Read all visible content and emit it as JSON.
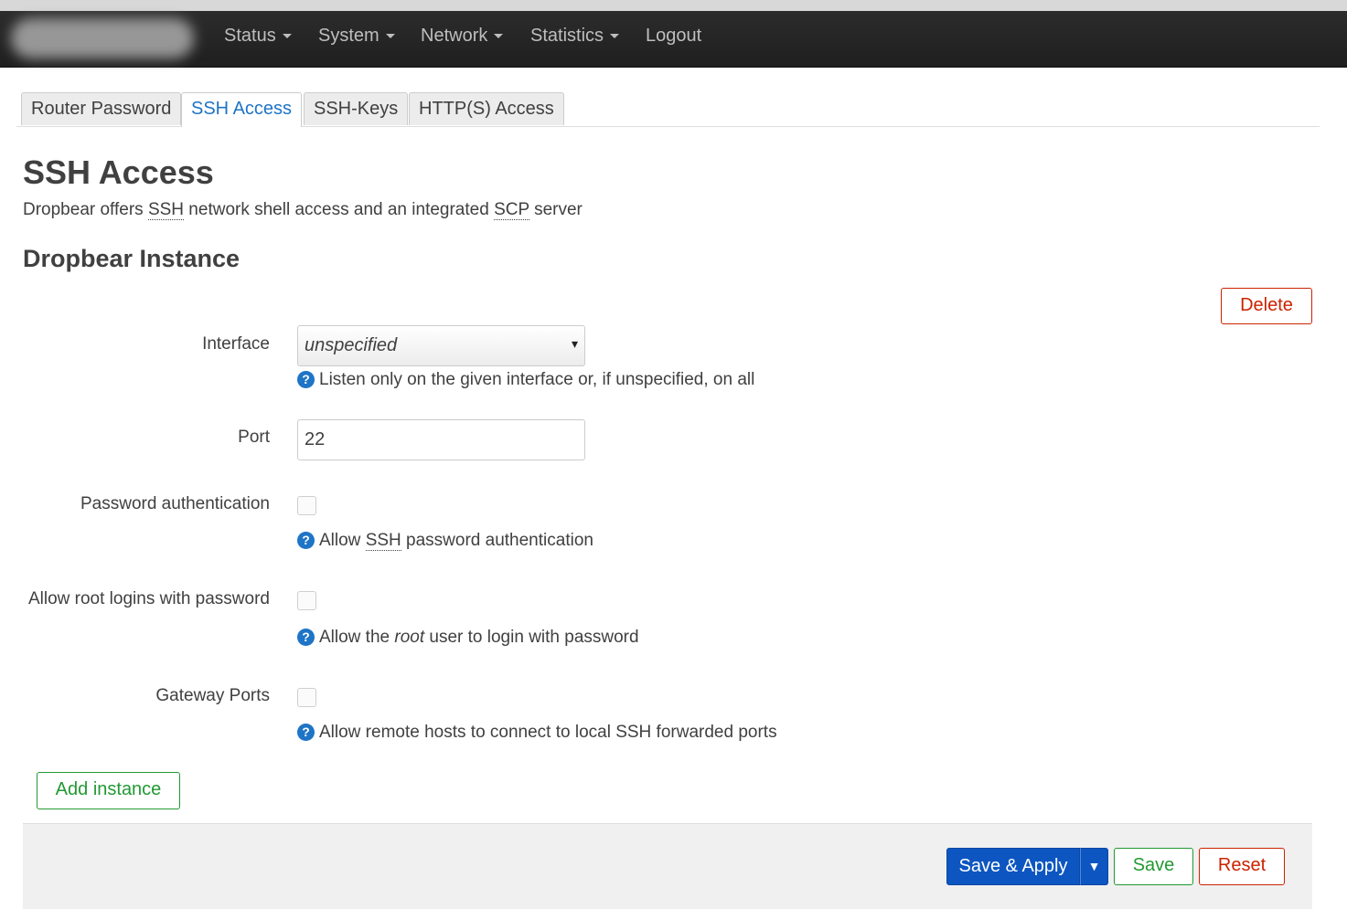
{
  "nav": {
    "items": [
      {
        "label": "Status",
        "has_dropdown": true
      },
      {
        "label": "System",
        "has_dropdown": true
      },
      {
        "label": "Network",
        "has_dropdown": true
      },
      {
        "label": "Statistics",
        "has_dropdown": true
      },
      {
        "label": "Logout",
        "has_dropdown": false
      }
    ]
  },
  "tabs": [
    {
      "label": "Router Password",
      "active": false
    },
    {
      "label": "SSH Access",
      "active": true
    },
    {
      "label": "SSH-Keys",
      "active": false
    },
    {
      "label": "HTTP(S) Access",
      "active": false
    }
  ],
  "page": {
    "title": "SSH Access",
    "desc_pre": "Dropbear offers ",
    "desc_abbr1": "SSH",
    "desc_mid": " network shell access and an integrated ",
    "desc_abbr2": "SCP",
    "desc_post": " server"
  },
  "section": {
    "title": "Dropbear Instance",
    "delete_label": "Delete"
  },
  "form": {
    "interface": {
      "label": "Interface",
      "value": "unspecified",
      "arrow": "▾",
      "help": "Listen only on the given interface or, if unspecified, on all"
    },
    "port": {
      "label": "Port",
      "value": "22"
    },
    "password_auth": {
      "label": "Password authentication",
      "checked": false,
      "help_pre": "Allow ",
      "help_abbr": "SSH",
      "help_post": " password authentication"
    },
    "root_password": {
      "label": "Allow root logins with password",
      "checked": false,
      "help_pre": "Allow the ",
      "help_em": "root",
      "help_post": " user to login with password"
    },
    "gateway_ports": {
      "label": "Gateway Ports",
      "checked": false,
      "help": "Allow remote hosts to connect to local SSH forwarded ports"
    }
  },
  "help_glyph": "?",
  "add_instance_label": "Add instance",
  "footer": {
    "save_apply_label": "Save & Apply",
    "save_apply_arrow": "▼",
    "save_label": "Save",
    "reset_label": "Reset"
  },
  "colors": {
    "navbar": "#242424",
    "link_blue": "#1e74c6",
    "primary_blue": "#0d56c1",
    "positive_green": "#229933",
    "negative_red": "#cc2200"
  }
}
